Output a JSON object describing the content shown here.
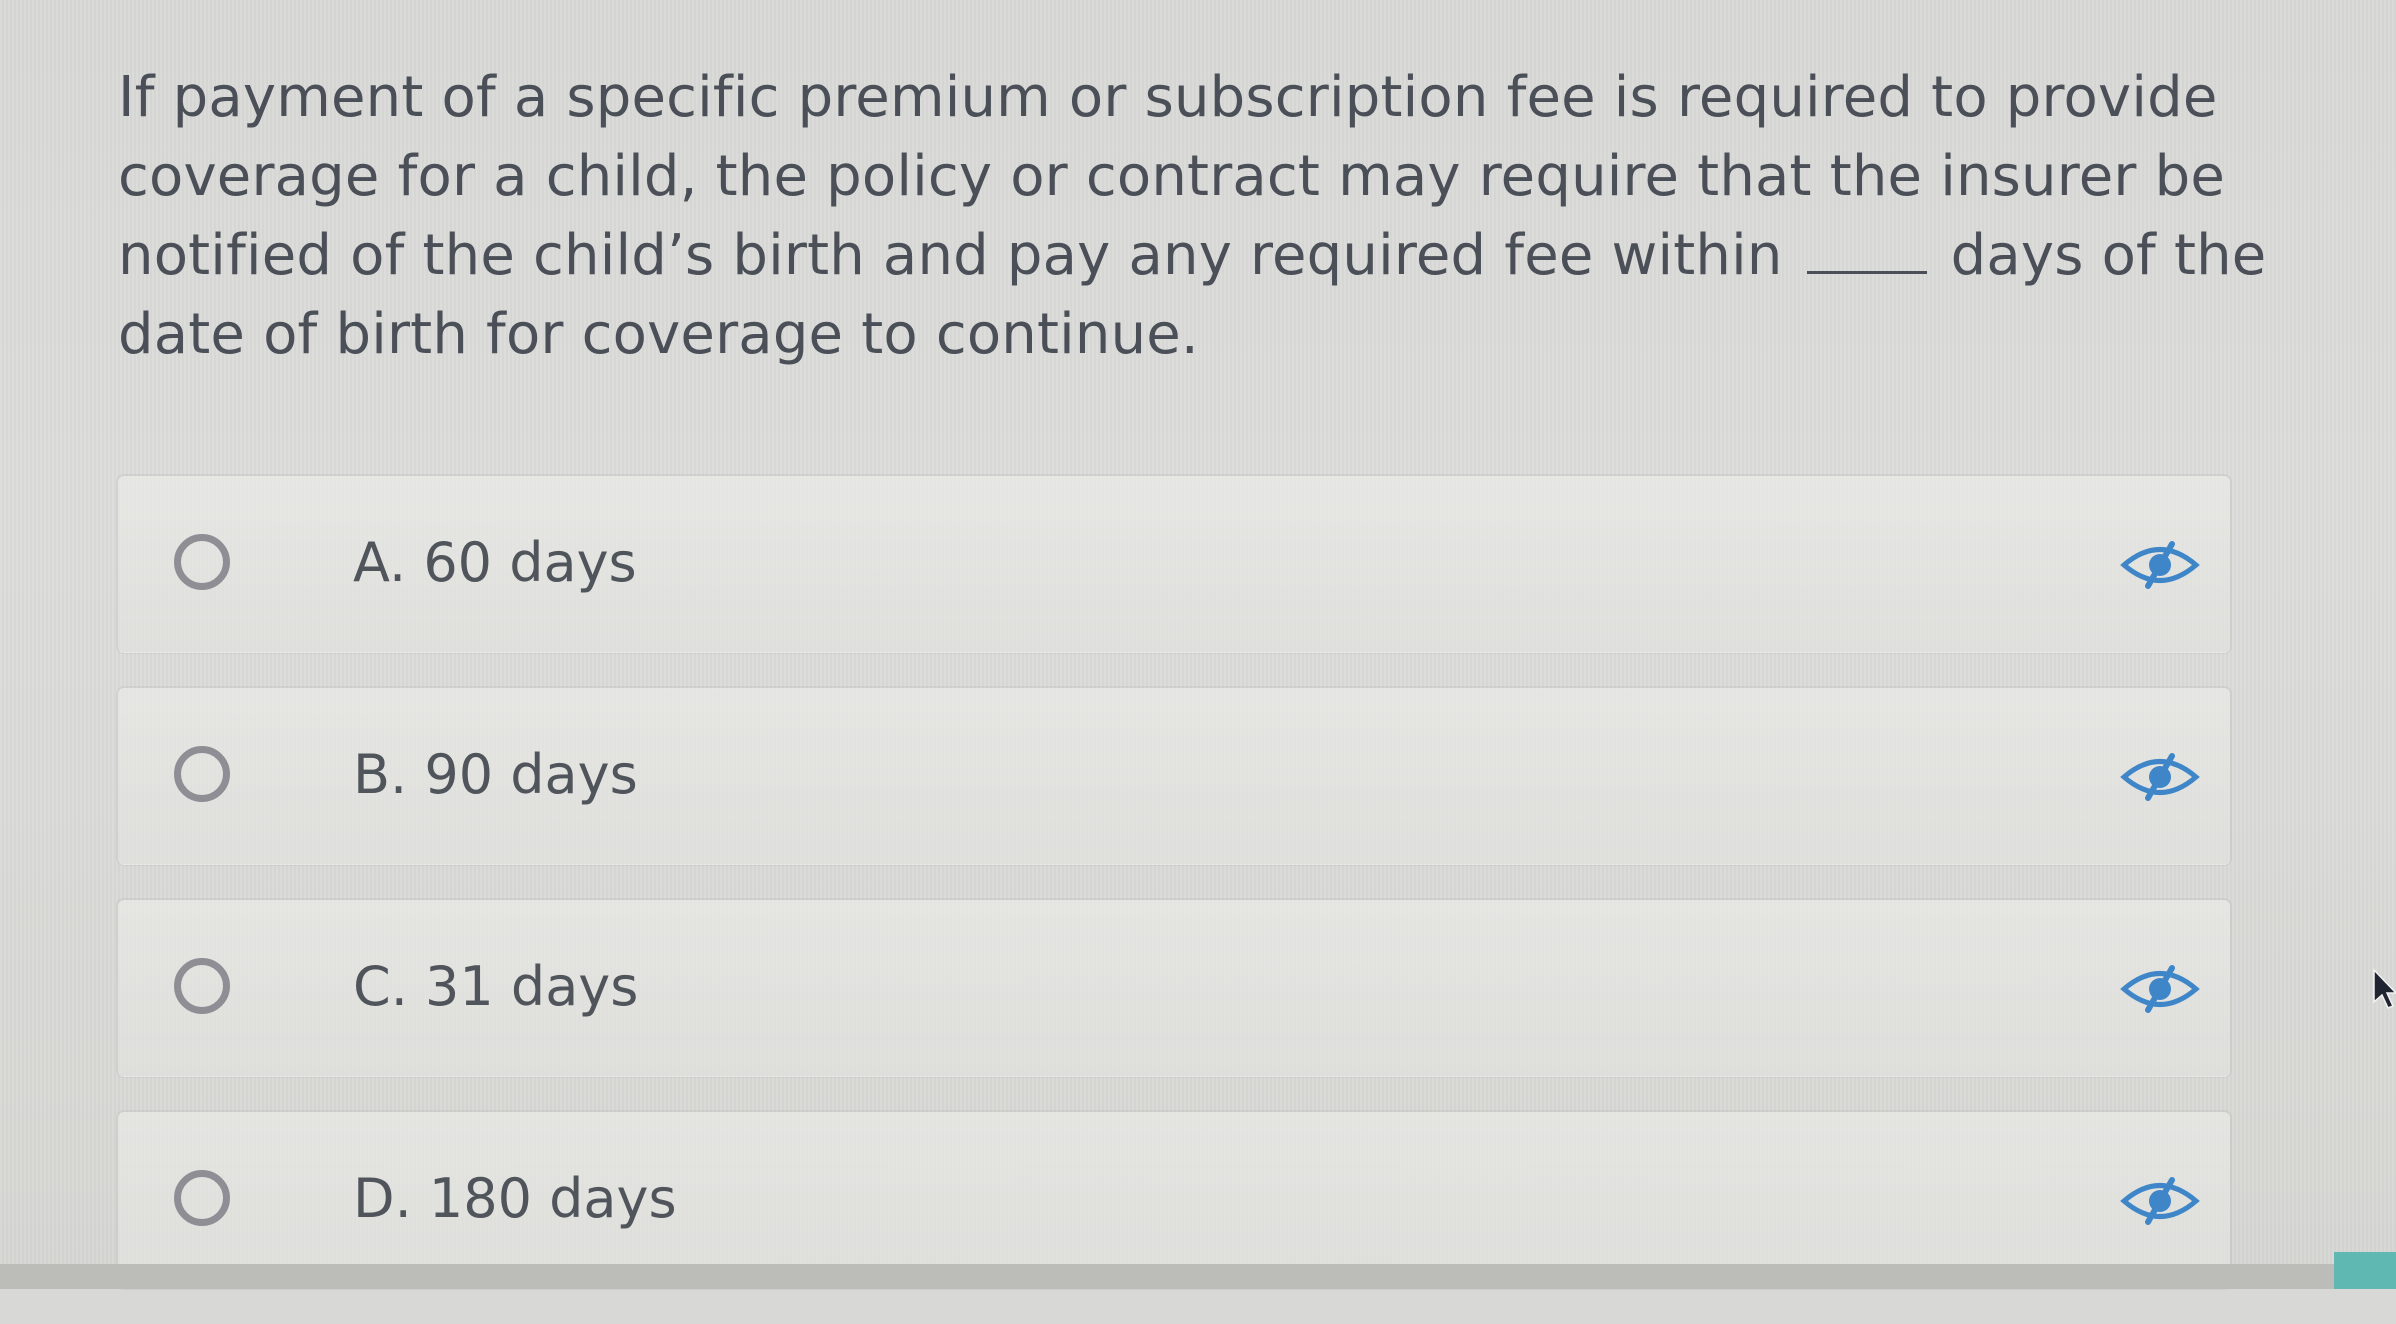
{
  "question": {
    "part1": "If payment of a specific premium or subscription fee is required to provide coverage for a child, the policy or contract may require that the insurer be notified of the child’s birth and pay any required fee within",
    "part2": "days of the date of birth for coverage to continue."
  },
  "options": [
    {
      "label": "A. 60 days"
    },
    {
      "label": "B. 90 days"
    },
    {
      "label": "C. 31 days"
    },
    {
      "label": "D. 180 days"
    }
  ],
  "icons": {
    "option_action": "eye-slash-icon",
    "cursor": "mouse-pointer-icon"
  },
  "colors": {
    "text": "#4b4f57",
    "radio_border": "#8f8e94",
    "eye_icon": "#3f86c9",
    "accent": "#5fb8b2"
  }
}
